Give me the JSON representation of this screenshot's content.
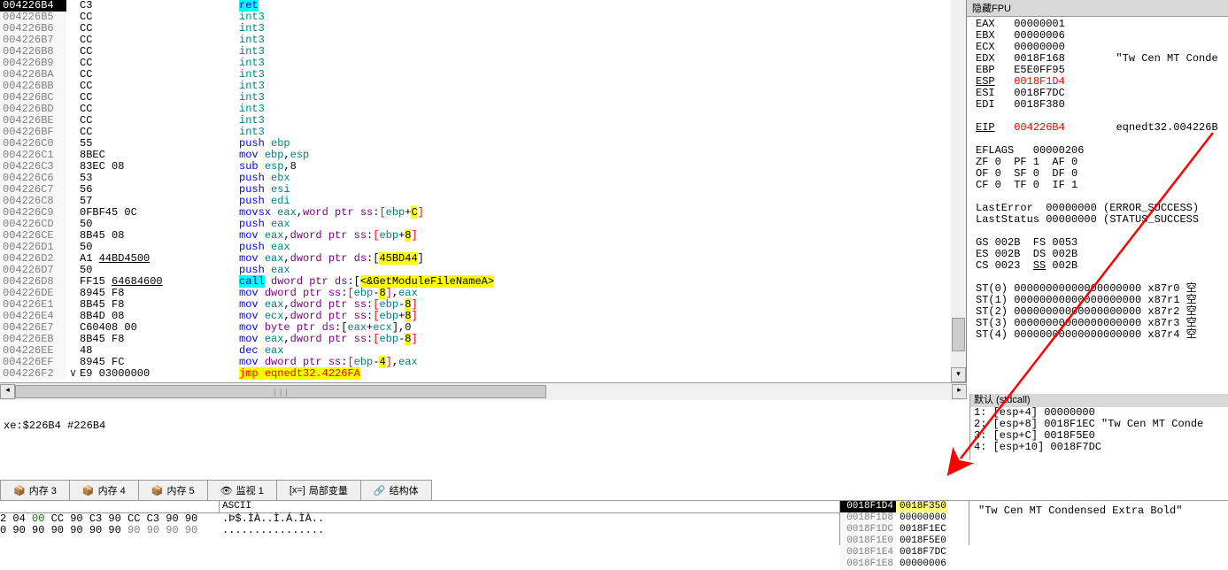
{
  "disasm": {
    "rows": [
      {
        "addr": "004226B4",
        "sel": true,
        "arrow": "",
        "bytes": "C3",
        "instr": [
          {
            "t": "ret",
            "cls": "hl-ret kw"
          }
        ]
      },
      {
        "addr": "004226B5",
        "bytes": "CC",
        "instr": [
          {
            "t": "int3",
            "cls": "reg"
          }
        ]
      },
      {
        "addr": "004226B6",
        "bytes": "CC",
        "instr": [
          {
            "t": "int3",
            "cls": "reg"
          }
        ]
      },
      {
        "addr": "004226B7",
        "bytes": "CC",
        "instr": [
          {
            "t": "int3",
            "cls": "reg"
          }
        ]
      },
      {
        "addr": "004226B8",
        "bytes": "CC",
        "instr": [
          {
            "t": "int3",
            "cls": "reg"
          }
        ]
      },
      {
        "addr": "004226B9",
        "bytes": "CC",
        "instr": [
          {
            "t": "int3",
            "cls": "reg"
          }
        ]
      },
      {
        "addr": "004226BA",
        "bytes": "CC",
        "instr": [
          {
            "t": "int3",
            "cls": "reg"
          }
        ]
      },
      {
        "addr": "004226BB",
        "bytes": "CC",
        "instr": [
          {
            "t": "int3",
            "cls": "reg"
          }
        ]
      },
      {
        "addr": "004226BC",
        "bytes": "CC",
        "instr": [
          {
            "t": "int3",
            "cls": "reg"
          }
        ]
      },
      {
        "addr": "004226BD",
        "bytes": "CC",
        "instr": [
          {
            "t": "int3",
            "cls": "reg"
          }
        ]
      },
      {
        "addr": "004226BE",
        "bytes": "CC",
        "instr": [
          {
            "t": "int3",
            "cls": "reg"
          }
        ]
      },
      {
        "addr": "004226BF",
        "bytes": "CC",
        "instr": [
          {
            "t": "int3",
            "cls": "reg"
          }
        ]
      },
      {
        "addr": "004226C0",
        "bytes": "55",
        "instr": [
          {
            "t": "push ",
            "cls": "kw"
          },
          {
            "t": "ebp",
            "cls": "reg"
          }
        ]
      },
      {
        "addr": "004226C1",
        "bytes": "8BEC",
        "instr": [
          {
            "t": "mov ",
            "cls": "kw"
          },
          {
            "t": "ebp",
            "cls": "reg"
          },
          {
            "t": ",",
            "cls": ""
          },
          {
            "t": "esp",
            "cls": "reg"
          }
        ]
      },
      {
        "addr": "004226C3",
        "bytes": "83EC 08",
        "instr": [
          {
            "t": "sub ",
            "cls": "kw"
          },
          {
            "t": "esp",
            "cls": "reg"
          },
          {
            "t": ",",
            "cls": ""
          },
          {
            "t": "8",
            "cls": "num"
          }
        ]
      },
      {
        "addr": "004226C6",
        "bytes": "53",
        "instr": [
          {
            "t": "push ",
            "cls": "kw"
          },
          {
            "t": "ebx",
            "cls": "reg"
          }
        ]
      },
      {
        "addr": "004226C7",
        "bytes": "56",
        "instr": [
          {
            "t": "push ",
            "cls": "kw"
          },
          {
            "t": "esi",
            "cls": "reg"
          }
        ]
      },
      {
        "addr": "004226C8",
        "bytes": "57",
        "instr": [
          {
            "t": "push ",
            "cls": "kw"
          },
          {
            "t": "edi",
            "cls": "reg"
          }
        ]
      },
      {
        "addr": "004226C9",
        "bytes": "0FBF45 0C",
        "instr": [
          {
            "t": "movsx ",
            "cls": "kw"
          },
          {
            "t": "eax",
            "cls": "reg"
          },
          {
            "t": ",",
            "cls": ""
          },
          {
            "t": "word ptr ",
            "cls": "seg"
          },
          {
            "t": "ss",
            "cls": "seg"
          },
          {
            "t": ":",
            "cls": ""
          },
          {
            "t": "[",
            "cls": "lb"
          },
          {
            "t": "ebp",
            "cls": "reg"
          },
          {
            "t": "+",
            "cls": ""
          },
          {
            "t": "C",
            "cls": "hl-mem"
          },
          {
            "t": "]",
            "cls": "rb"
          }
        ]
      },
      {
        "addr": "004226CD",
        "bytes": "50",
        "instr": [
          {
            "t": "push ",
            "cls": "kw"
          },
          {
            "t": "eax",
            "cls": "reg"
          }
        ]
      },
      {
        "addr": "004226CE",
        "bytes": "8B45 08",
        "instr": [
          {
            "t": "mov ",
            "cls": "kw"
          },
          {
            "t": "eax",
            "cls": "reg"
          },
          {
            "t": ",",
            "cls": ""
          },
          {
            "t": "dword ptr ",
            "cls": "seg"
          },
          {
            "t": "ss",
            "cls": "seg"
          },
          {
            "t": ":",
            "cls": ""
          },
          {
            "t": "[",
            "cls": "lb"
          },
          {
            "t": "ebp",
            "cls": "reg"
          },
          {
            "t": "+",
            "cls": ""
          },
          {
            "t": "8",
            "cls": "hl-mem"
          },
          {
            "t": "]",
            "cls": "rb"
          }
        ]
      },
      {
        "addr": "004226D1",
        "bytes": "50",
        "instr": [
          {
            "t": "push ",
            "cls": "kw"
          },
          {
            "t": "eax",
            "cls": "reg"
          }
        ]
      },
      {
        "addr": "004226D2",
        "bytes": "A1 ",
        "bytes_u": "44BD4500",
        "instr": [
          {
            "t": "mov ",
            "cls": "kw"
          },
          {
            "t": "eax",
            "cls": "reg"
          },
          {
            "t": ",",
            "cls": ""
          },
          {
            "t": "dword ptr ",
            "cls": "seg"
          },
          {
            "t": "ds",
            "cls": "seg"
          },
          {
            "t": ":[",
            "cls": ""
          },
          {
            "t": "45BD44",
            "cls": "hl-mem"
          },
          {
            "t": "]",
            "cls": ""
          }
        ]
      },
      {
        "addr": "004226D7",
        "bytes": "50",
        "instr": [
          {
            "t": "push ",
            "cls": "kw"
          },
          {
            "t": "eax",
            "cls": "reg"
          }
        ]
      },
      {
        "addr": "004226D8",
        "bytes": "FF15 ",
        "bytes_u": "64684600",
        "instr": [
          {
            "t": "call",
            "cls": "hl-call kw"
          },
          {
            "t": " ",
            "cls": ""
          },
          {
            "t": "dword ptr ",
            "cls": "seg"
          },
          {
            "t": "ds",
            "cls": "seg"
          },
          {
            "t": ":[",
            "cls": ""
          },
          {
            "t": "<&GetModuleFileNameA>",
            "cls": "hl-api"
          }
        ]
      },
      {
        "addr": "004226DE",
        "bytes": "8945 F8",
        "instr": [
          {
            "t": "mov ",
            "cls": "kw"
          },
          {
            "t": "dword ptr ",
            "cls": "seg"
          },
          {
            "t": "ss",
            "cls": "seg"
          },
          {
            "t": ":",
            "cls": ""
          },
          {
            "t": "[",
            "cls": "lb"
          },
          {
            "t": "ebp",
            "cls": "reg"
          },
          {
            "t": "-",
            "cls": ""
          },
          {
            "t": "8",
            "cls": "hl-mem"
          },
          {
            "t": "]",
            "cls": "rb"
          },
          {
            "t": ",",
            "cls": ""
          },
          {
            "t": "eax",
            "cls": "reg"
          }
        ]
      },
      {
        "addr": "004226E1",
        "bytes": "8B45 F8",
        "instr": [
          {
            "t": "mov ",
            "cls": "kw"
          },
          {
            "t": "eax",
            "cls": "reg"
          },
          {
            "t": ",",
            "cls": ""
          },
          {
            "t": "dword ptr ",
            "cls": "seg"
          },
          {
            "t": "ss",
            "cls": "seg"
          },
          {
            "t": ":",
            "cls": ""
          },
          {
            "t": "[",
            "cls": "lb"
          },
          {
            "t": "ebp",
            "cls": "reg"
          },
          {
            "t": "-",
            "cls": ""
          },
          {
            "t": "8",
            "cls": "hl-mem"
          },
          {
            "t": "]",
            "cls": "rb"
          }
        ]
      },
      {
        "addr": "004226E4",
        "bytes": "8B4D 08",
        "instr": [
          {
            "t": "mov ",
            "cls": "kw"
          },
          {
            "t": "ecx",
            "cls": "reg"
          },
          {
            "t": ",",
            "cls": ""
          },
          {
            "t": "dword ptr ",
            "cls": "seg"
          },
          {
            "t": "ss",
            "cls": "seg"
          },
          {
            "t": ":",
            "cls": ""
          },
          {
            "t": "[",
            "cls": "lb"
          },
          {
            "t": "ebp",
            "cls": "reg"
          },
          {
            "t": "+",
            "cls": ""
          },
          {
            "t": "8",
            "cls": "hl-mem"
          },
          {
            "t": "]",
            "cls": "rb"
          }
        ]
      },
      {
        "addr": "004226E7",
        "bytes": "C60408 00",
        "instr": [
          {
            "t": "mov ",
            "cls": "kw"
          },
          {
            "t": "byte ptr ",
            "cls": "seg"
          },
          {
            "t": "ds",
            "cls": "seg"
          },
          {
            "t": ":[",
            "cls": ""
          },
          {
            "t": "eax",
            "cls": "reg"
          },
          {
            "t": "+",
            "cls": ""
          },
          {
            "t": "ecx",
            "cls": "reg"
          },
          {
            "t": "],",
            "cls": ""
          },
          {
            "t": "0",
            "cls": "num"
          }
        ]
      },
      {
        "addr": "004226EB",
        "bytes": "8B45 F8",
        "instr": [
          {
            "t": "mov ",
            "cls": "kw"
          },
          {
            "t": "eax",
            "cls": "reg"
          },
          {
            "t": ",",
            "cls": ""
          },
          {
            "t": "dword ptr ",
            "cls": "seg"
          },
          {
            "t": "ss",
            "cls": "seg"
          },
          {
            "t": ":",
            "cls": ""
          },
          {
            "t": "[",
            "cls": "lb"
          },
          {
            "t": "ebp",
            "cls": "reg"
          },
          {
            "t": "-",
            "cls": ""
          },
          {
            "t": "8",
            "cls": "hl-mem"
          },
          {
            "t": "]",
            "cls": "rb"
          }
        ]
      },
      {
        "addr": "004226EE",
        "bytes": "48",
        "instr": [
          {
            "t": "dec ",
            "cls": "kw"
          },
          {
            "t": "eax",
            "cls": "reg"
          }
        ]
      },
      {
        "addr": "004226EF",
        "bytes": "8945 FC",
        "instr": [
          {
            "t": "mov ",
            "cls": "kw"
          },
          {
            "t": "dword ptr ",
            "cls": "seg"
          },
          {
            "t": "ss",
            "cls": "seg"
          },
          {
            "t": ":",
            "cls": ""
          },
          {
            "t": "[",
            "cls": "lb"
          },
          {
            "t": "ebp",
            "cls": "reg"
          },
          {
            "t": "-",
            "cls": ""
          },
          {
            "t": "4",
            "cls": "hl-mem"
          },
          {
            "t": "]",
            "cls": "rb"
          },
          {
            "t": ",",
            "cls": ""
          },
          {
            "t": "eax",
            "cls": "reg"
          }
        ]
      },
      {
        "addr": "004226F2",
        "arrow": "∨",
        "bytes": "E9 03000000",
        "instr": [
          {
            "t": "jmp ",
            "cls": "hl-jmp"
          },
          {
            "t": "eqnedt32.4226FA",
            "cls": "hl-jmp"
          }
        ]
      }
    ]
  },
  "registers": {
    "hide_label": "隐藏FPU",
    "gp": [
      {
        "name": "EAX",
        "val": "00000001"
      },
      {
        "name": "EBX",
        "val": "00000006"
      },
      {
        "name": "ECX",
        "val": "00000000"
      },
      {
        "name": "EDX",
        "val": "0018F168",
        "extra": "\"Tw Cen MT Conde"
      },
      {
        "name": "EBP",
        "val": "E5E0FF95"
      },
      {
        "name": "ESP",
        "val": "0018F1D4",
        "red": true,
        "u": true
      },
      {
        "name": "ESI",
        "val": "0018F7DC"
      },
      {
        "name": "EDI",
        "val": "0018F380"
      }
    ],
    "eip": {
      "name": "EIP",
      "val": "004226B4",
      "extra": "eqnedt32.004226B",
      "red": true,
      "u": true
    },
    "eflags": "EFLAGS   00000206",
    "flags": [
      "ZF 0  PF 1  AF 0",
      "OF 0  SF 0  DF 0",
      "CF 0  TF 0  IF 1"
    ],
    "errors": [
      "LastError  00000000 (ERROR_SUCCESS)",
      "LastStatus 00000000 (STATUS_SUCCESS"
    ],
    "segs": [
      "GS 002B  FS 0053",
      "ES 002B  DS 002B",
      "CS 0023  <u>SS</u> 002B"
    ],
    "fpu": [
      "ST(0) 00000000000000000000 x87r0 空",
      "ST(1) 00000000000000000000 x87r1 空",
      "ST(2) 00000000000000000000 x87r2 空",
      "ST(3) 00000000000000000000 x87r3 空",
      "ST(4) 00000000000000000000 x87r4 空"
    ]
  },
  "status": "xe:$226B4 #226B4",
  "callstack": {
    "header": "默认 (stdcall)",
    "rows": [
      "1: [esp+4] 00000000",
      "2: [esp+8] 0018F1EC \"Tw Cen MT Conde",
      "3: [esp+C] 0018F5E0",
      "4: [esp+10] 0018F7DC"
    ]
  },
  "tabs": [
    {
      "icon": "📦",
      "label": "内存 3"
    },
    {
      "icon": "📦",
      "label": "内存 4"
    },
    {
      "icon": "📦",
      "label": "内存 5"
    },
    {
      "icon": "👁",
      "label": "监视 1"
    },
    {
      "icon": "[x=]",
      "label": "局部变量"
    },
    {
      "icon": "🔗",
      "label": "结构体"
    }
  ],
  "hex": {
    "ascii_header": "ASCII",
    "rows": [
      {
        "b": "2 04 <g>00</g> CC 90 C3 90 CC C3 90 90",
        "a": ".Þ$.ÌÀ..Ì.Á.ÌÀ.."
      },
      {
        "b": "0 90 90 90 90 90 90 <z>90 90 90 90</z>",
        "a": "................"
      }
    ]
  },
  "stack": {
    "rows": [
      {
        "addr": "0018F1D4",
        "val": "0018F350",
        "sel": true,
        "hl": true
      },
      {
        "addr": "0018F1D8",
        "val": "00000000"
      },
      {
        "addr": "0018F1DC",
        "val": "0018F1EC"
      },
      {
        "addr": "0018F1E0",
        "val": "0018F5E0"
      },
      {
        "addr": "0018F1E4",
        "val": "0018F7DC"
      },
      {
        "addr": "0018F1E8",
        "val": "00000006"
      }
    ]
  },
  "str_panel": "\"Tw Cen MT Condensed Extra Bold\""
}
